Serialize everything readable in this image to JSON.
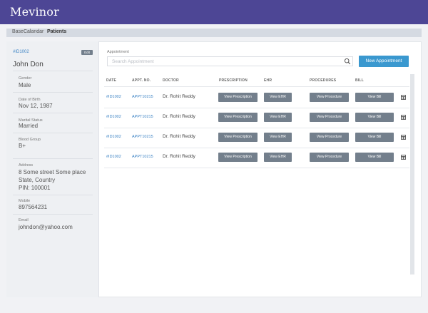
{
  "app": {
    "brand": "Mevinor"
  },
  "breadcrumb": {
    "items": [
      "BaseCalandar",
      "Patients"
    ]
  },
  "patient": {
    "id": "#ID1002",
    "edit_label": "Edit",
    "name": "John Don",
    "fields": [
      {
        "label": "Gender",
        "value": "Male"
      },
      {
        "label": "Date of Birth",
        "value": "Nov 12, 1987"
      },
      {
        "label": "Marital Status",
        "value": "Married"
      },
      {
        "label": "Blood Group",
        "value": "B+"
      },
      {
        "label": "Address",
        "lines": [
          "8 Some street Some place",
          "State, Country",
          "PIN: 100001"
        ]
      },
      {
        "label": "Mobile",
        "value": "897564231"
      },
      {
        "label": "Email",
        "value": "johndon@yahoo.com"
      }
    ]
  },
  "appointments": {
    "label": "Appointment",
    "search_placeholder": "Search Appointment",
    "new_button": "New Appointment",
    "columns": [
      "DATE",
      "APPT. NO.",
      "DOCTOR",
      "PRESCRIPTION",
      "EHR",
      "PROCEDURES",
      "BILL"
    ],
    "rows": [
      {
        "date": "#ID1002",
        "appt_no": "APPT10215",
        "doctor": "Dr. Rohit Reddy",
        "prescription": "View Prescription",
        "ehr": "View EHR",
        "procedures": "View Procedure",
        "bill": "View Bill"
      },
      {
        "date": "#ID1002",
        "appt_no": "APPT10215",
        "doctor": "Dr. Rohit Reddy",
        "prescription": "View Prescription",
        "ehr": "View EHR",
        "procedures": "View Procedure",
        "bill": "View Bill"
      },
      {
        "date": "#ID1002",
        "appt_no": "APPT10215",
        "doctor": "Dr. Rohit Reddy",
        "prescription": "View Prescription",
        "ehr": "View EHR",
        "procedures": "View Procedure",
        "bill": "View Bill"
      },
      {
        "date": "#ID1002",
        "appt_no": "APPT10215",
        "doctor": "Dr. Rohit Reddy",
        "prescription": "View Prescription",
        "ehr": "View EHR",
        "procedures": "View Procedure",
        "bill": "View Bill"
      }
    ],
    "row_icon": "table-icon"
  },
  "colors": {
    "header": "#4d4695",
    "accent": "#3a98cf",
    "button": "#737f8c",
    "link": "#3b82c4"
  }
}
